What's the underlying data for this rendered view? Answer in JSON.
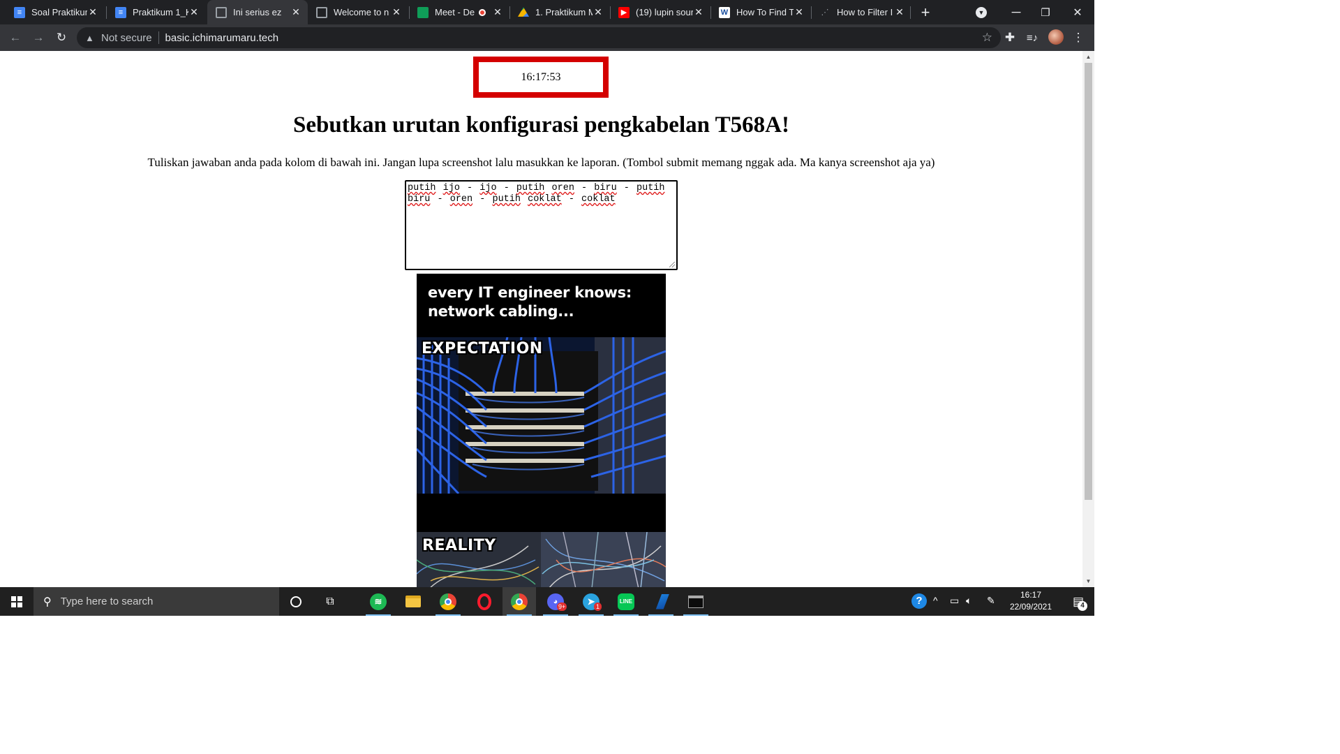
{
  "browser": {
    "tabs": [
      {
        "title": "Soal Praktikum",
        "icon": "docs-icon"
      },
      {
        "title": "Praktikum 1_K",
        "icon": "docs-icon"
      },
      {
        "title": "Ini serius ez",
        "icon": "globe-icon",
        "active": true
      },
      {
        "title": "Welcome to n",
        "icon": "globe-icon"
      },
      {
        "title": "Meet - De",
        "icon": "meet-icon",
        "recording": true
      },
      {
        "title": "1. Praktikum M",
        "icon": "drive-icon"
      },
      {
        "title": "(19) lupin sour",
        "icon": "youtube-icon"
      },
      {
        "title": "How To Find T",
        "icon": "w-site-icon"
      },
      {
        "title": "How to Filter I",
        "icon": "loading-icon"
      }
    ],
    "security_label": "Not secure",
    "url": "basic.ichimarumaru.tech"
  },
  "page": {
    "clock": "16:17:53",
    "question": "Sebutkan urutan konfigurasi pengkabelan T568A!",
    "instructions": "Tuliskan jawaban anda pada kolom di bawah ini. Jangan lupa screenshot lalu masukkan ke laporan. (Tombol submit memang nggak ada. Ma kanya screenshot aja ya)",
    "answer": "putih ijo - ijo - putih oren - biru - putih biru - oren - putih coklat - coklat",
    "meme": {
      "caption": "every IT engineer knows: network cabling...",
      "top_label": "EXPECTATION",
      "bottom_label": "REALITY"
    }
  },
  "taskbar": {
    "search_placeholder": "Type here to search",
    "time": "16:17",
    "date": "22/09/2021",
    "notification_count": "4",
    "discord_badge": "9+",
    "telegram_badge": "1"
  },
  "colors": {
    "clock_border": "#d40000",
    "chrome_dark": "#202124",
    "chrome_toolbar": "#35363a",
    "taskbar": "#202020"
  }
}
